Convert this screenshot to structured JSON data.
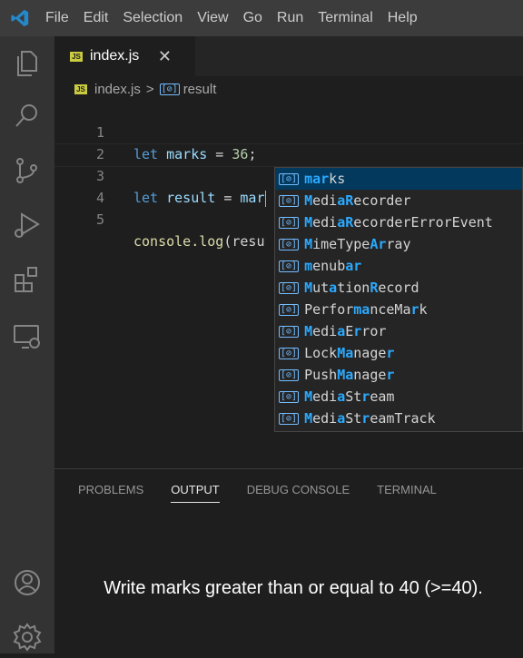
{
  "menu": [
    "File",
    "Edit",
    "Selection",
    "View",
    "Go",
    "Run",
    "Terminal",
    "Help"
  ],
  "tab": {
    "badge": "JS",
    "label": "index.js",
    "close": "✕"
  },
  "breadcrumb": {
    "badge": "JS",
    "file": "index.js",
    "separator": ">",
    "symbol_icon": "[⊘]",
    "symbol": "result"
  },
  "code_lines": [
    {
      "num": "1",
      "kw": "let ",
      "id": "marks",
      "rest": " = ",
      "num_val": "36",
      "end": ";"
    },
    {
      "num": "2"
    },
    {
      "num": "3",
      "kw": "let ",
      "id": "result",
      "rest": " = ",
      "typed": "mar"
    },
    {
      "num": "4"
    },
    {
      "num": "5",
      "fn": "console.log",
      "rest": "(resu"
    }
  ],
  "suggestions": {
    "icon": "[⊘]",
    "items": [
      {
        "label": "marks",
        "selected": true
      },
      {
        "label": "MediaRecorder"
      },
      {
        "label": "MediaRecorderErrorEvent"
      },
      {
        "label": "MimeTypeArray"
      },
      {
        "label": "menubar"
      },
      {
        "label": "MutationRecord"
      },
      {
        "label": "PerformanceMark"
      },
      {
        "label": "MediaError"
      },
      {
        "label": "LockManager"
      },
      {
        "label": "PushManager"
      },
      {
        "label": "MediaStream"
      },
      {
        "label": "MediaStreamTrack"
      }
    ]
  },
  "panel_tabs": [
    {
      "label": "PROBLEMS"
    },
    {
      "label": "OUTPUT",
      "active": true
    },
    {
      "label": "DEBUG CONSOLE"
    },
    {
      "label": "TERMINAL"
    }
  ],
  "caption": "Write marks greater than or equal to 40 (>=40).",
  "colors": {
    "accent": "#007acc",
    "selection": "#04395e",
    "match_highlight": "#2aaaff",
    "js_badge": "#cbcb41"
  },
  "icons": [
    "vscode-logo-icon",
    "explorer-icon",
    "search-icon",
    "source-control-icon",
    "run-debug-icon",
    "extensions-icon",
    "remote-explorer-icon",
    "account-icon",
    "settings-gear-icon"
  ]
}
